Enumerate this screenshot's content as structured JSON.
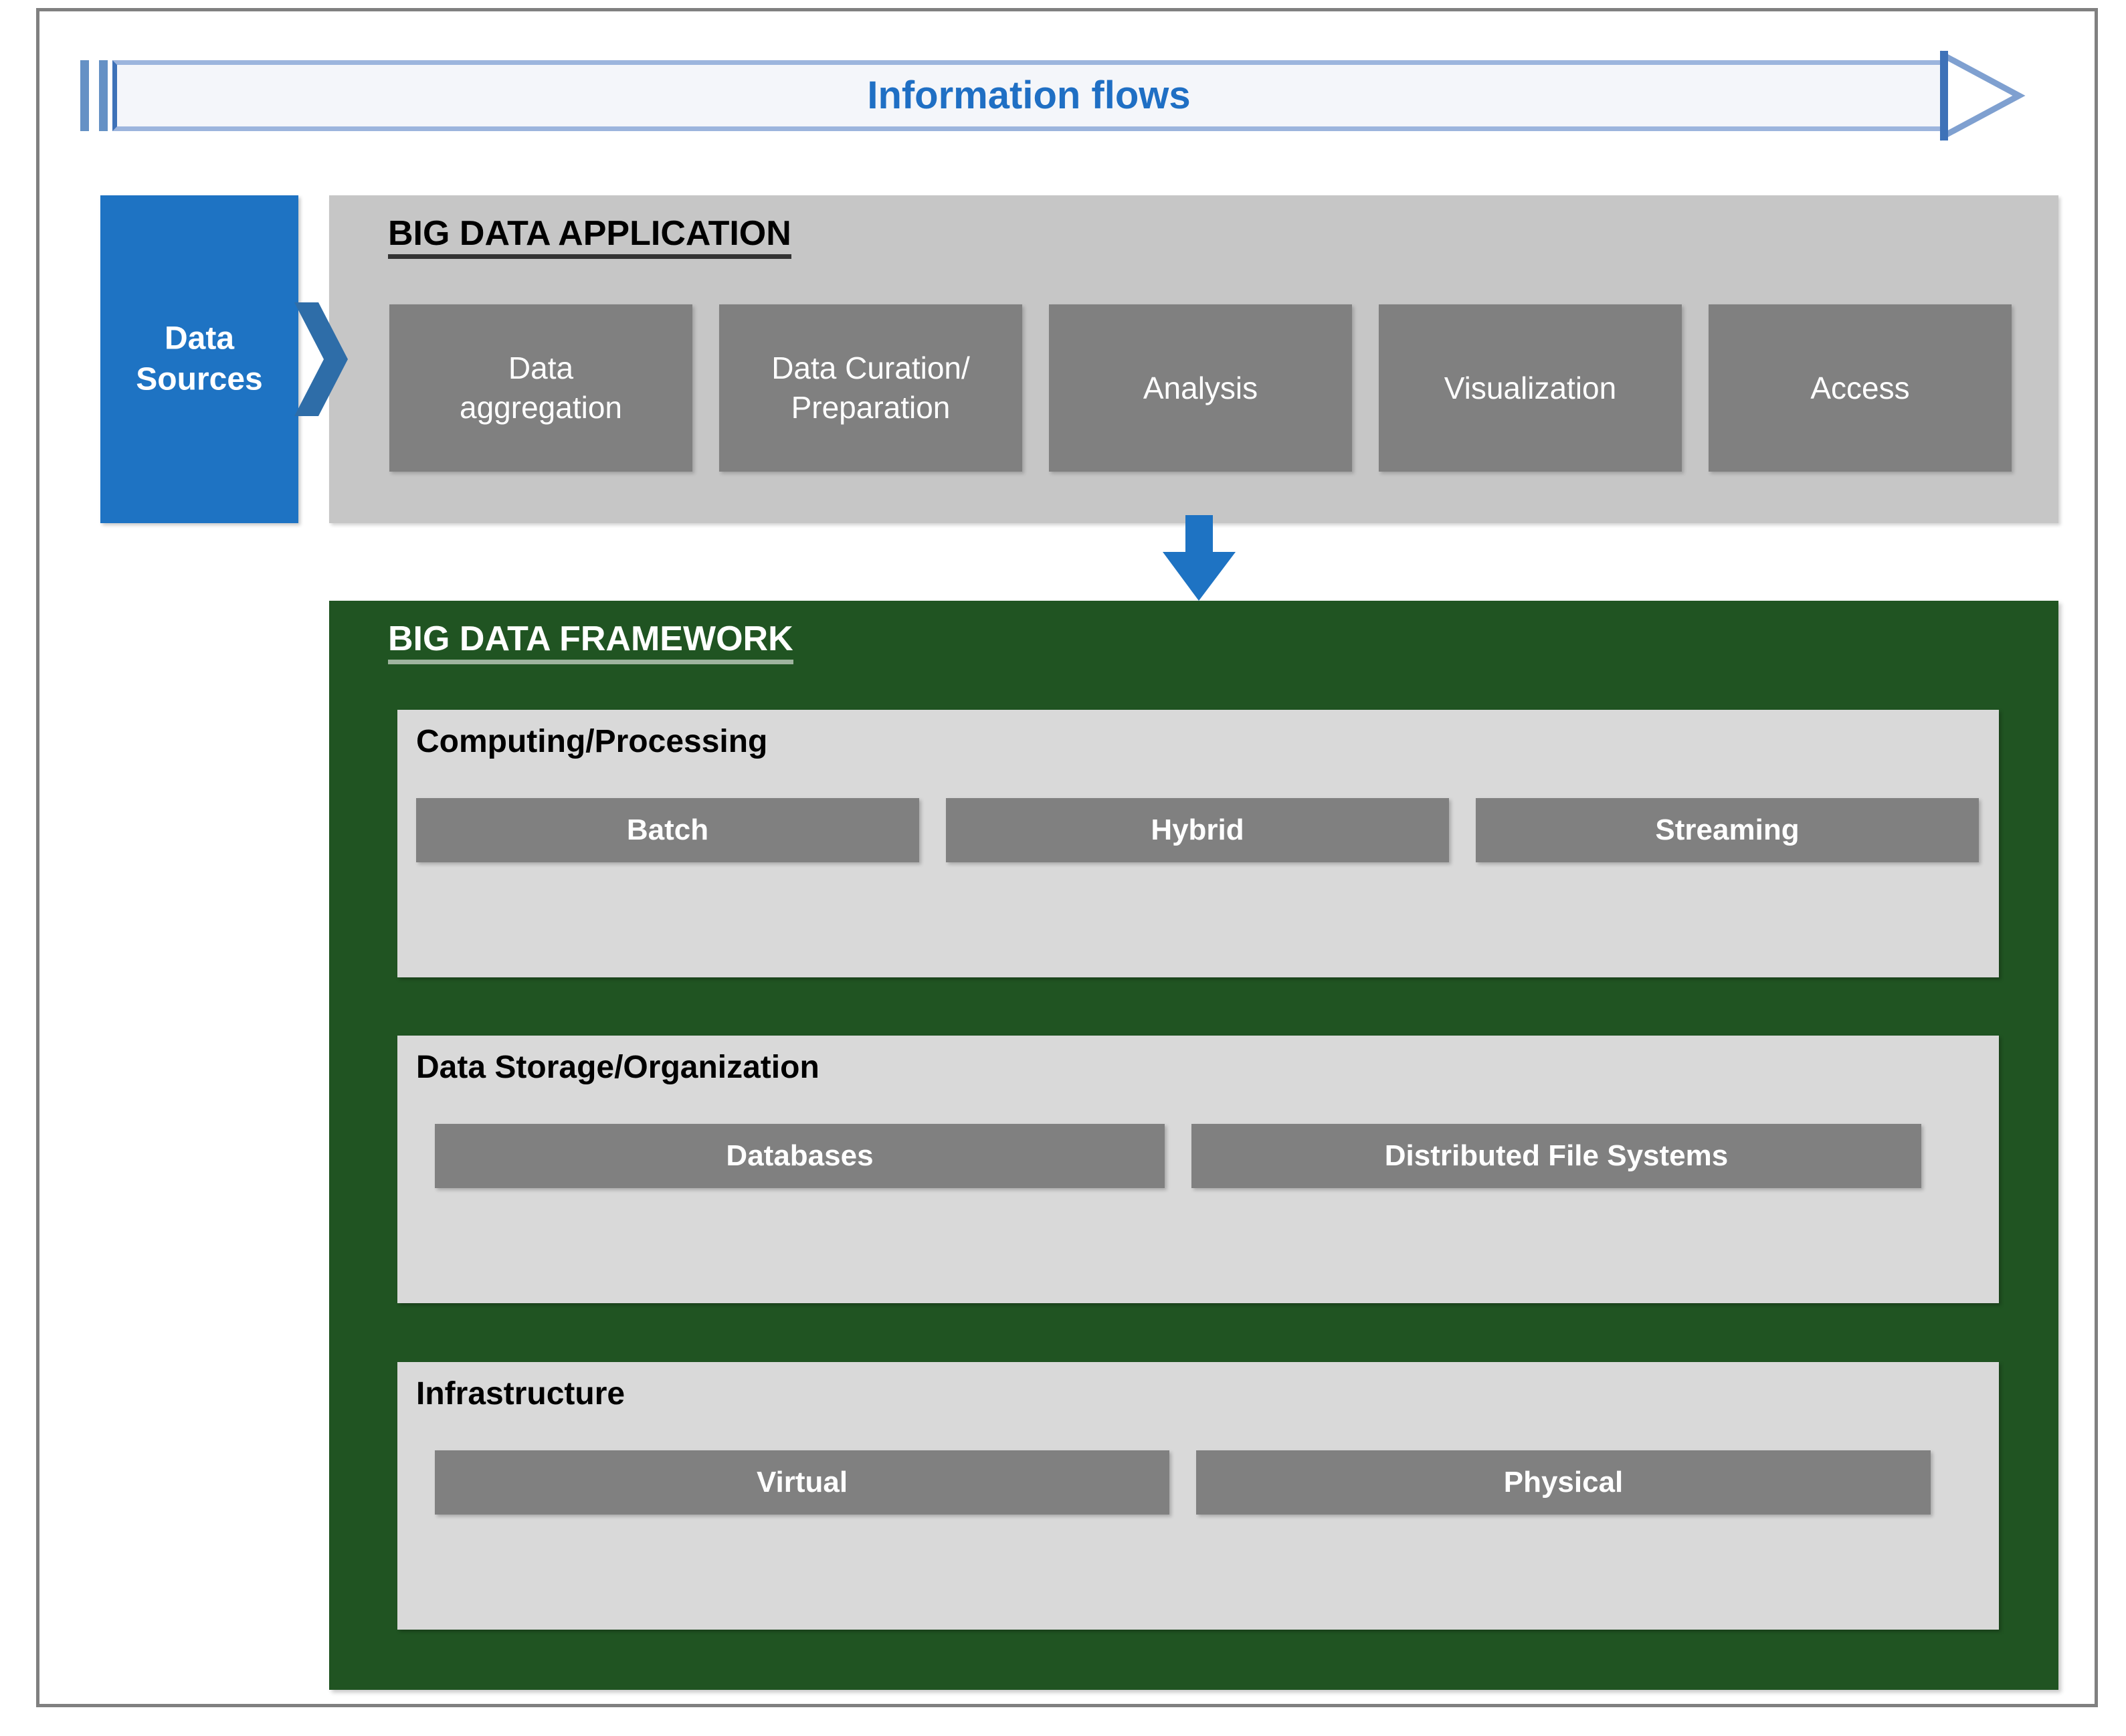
{
  "diagram": {
    "flow_banner": {
      "title": "Information flows",
      "arrow_direction": "right",
      "color": "#1F6FC4",
      "body_fill": "#F4F6FA",
      "outline": "#3E72B8"
    },
    "data_sources": {
      "label": "Data\nSources",
      "line1": "Data",
      "line2": "Sources",
      "fill": "#1E73C3",
      "text_color": "#FFFFFF"
    },
    "application": {
      "title": "BIG DATA APPLICATION",
      "panel_fill": "#C6C6C6",
      "box_fill": "#808080",
      "stages": [
        {
          "label": "Data aggregation",
          "line1": "Data",
          "line2": "aggregation"
        },
        {
          "label": "Data Curation/ Preparation",
          "line1": "Data Curation/",
          "line2": "Preparation"
        },
        {
          "label": "Analysis",
          "line1": "Analysis",
          "line2": ""
        },
        {
          "label": "Visualization",
          "line1": "Visualization",
          "line2": ""
        },
        {
          "label": "Access",
          "line1": "Access",
          "line2": ""
        }
      ]
    },
    "connector": {
      "name": "down-arrow",
      "direction": "down",
      "color": "#1E73C3"
    },
    "framework": {
      "title": "BIG DATA FRAMEWORK",
      "panel_fill": "#205422",
      "layer_fill": "#D9D9D9",
      "box_fill": "#808080",
      "layers": [
        {
          "title": "Computing/Processing",
          "items": [
            "Batch",
            "Hybrid",
            "Streaming"
          ]
        },
        {
          "title": "Data Storage/Organization",
          "items": [
            "Databases",
            "Distributed File Systems"
          ]
        },
        {
          "title": "Infrastructure",
          "items": [
            "Virtual",
            "Physical"
          ]
        }
      ]
    }
  }
}
